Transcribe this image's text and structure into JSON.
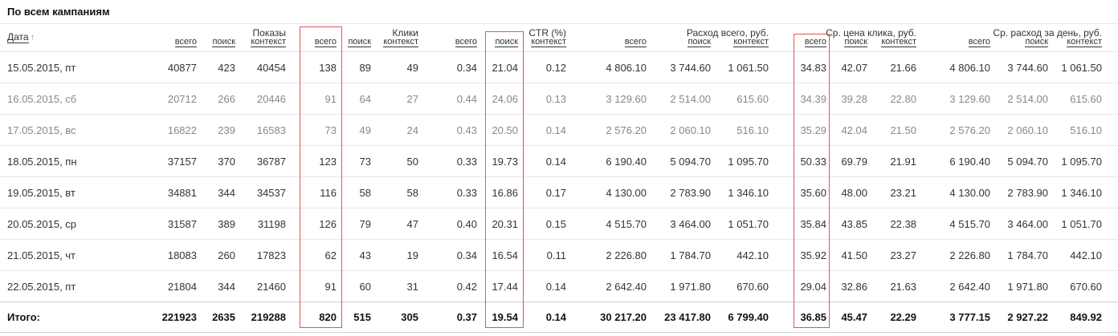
{
  "title": "По всем кампаниям",
  "headers": {
    "date": "Дата",
    "date_sort_icon": "arrow-up-icon",
    "vsego": "всего",
    "poisk": "поиск",
    "kontekst": "контекст",
    "groups": {
      "pokazy": "Показы",
      "kliki": "Клики",
      "ctr": "CTR (%)",
      "rashod": "Расход всего, руб.",
      "cena": "Ср. цена клика, руб.",
      "rashod_den": "Ср. расход за день, руб."
    }
  },
  "rows": [
    {
      "date": "15.05.2015, пт",
      "show_total": "40877",
      "show_search": "423",
      "show_context": "40454",
      "clicks_total": "138",
      "clicks_search": "89",
      "clicks_context": "49",
      "ctr_total": "0.34",
      "ctr_search": "21.04",
      "ctr_context": "0.12",
      "spend_total": "4 806.10",
      "spend_search": "3 744.60",
      "spend_context": "1 061.50",
      "cpc_total": "34.83",
      "cpc_search": "42.07",
      "cpc_context": "21.66",
      "day_total": "4 806.10",
      "day_search": "3 744.60",
      "day_context": "1 061.50"
    },
    {
      "date": "16.05.2015, сб",
      "show_total": "20712",
      "show_search": "266",
      "show_context": "20446",
      "clicks_total": "91",
      "clicks_search": "64",
      "clicks_context": "27",
      "ctr_total": "0.44",
      "ctr_search": "24.06",
      "ctr_context": "0.13",
      "spend_total": "3 129.60",
      "spend_search": "2 514.00",
      "spend_context": "615.60",
      "cpc_total": "34.39",
      "cpc_search": "39.28",
      "cpc_context": "22.80",
      "day_total": "3 129.60",
      "day_search": "2 514.00",
      "day_context": "615.60"
    },
    {
      "date": "17.05.2015, вс",
      "show_total": "16822",
      "show_search": "239",
      "show_context": "16583",
      "clicks_total": "73",
      "clicks_search": "49",
      "clicks_context": "24",
      "ctr_total": "0.43",
      "ctr_search": "20.50",
      "ctr_context": "0.14",
      "spend_total": "2 576.20",
      "spend_search": "2 060.10",
      "spend_context": "516.10",
      "cpc_total": "35.29",
      "cpc_search": "42.04",
      "cpc_context": "21.50",
      "day_total": "2 576.20",
      "day_search": "2 060.10",
      "day_context": "516.10"
    },
    {
      "date": "18.05.2015, пн",
      "show_total": "37157",
      "show_search": "370",
      "show_context": "36787",
      "clicks_total": "123",
      "clicks_search": "73",
      "clicks_context": "50",
      "ctr_total": "0.33",
      "ctr_search": "19.73",
      "ctr_context": "0.14",
      "spend_total": "6 190.40",
      "spend_search": "5 094.70",
      "spend_context": "1 095.70",
      "cpc_total": "50.33",
      "cpc_search": "69.79",
      "cpc_context": "21.91",
      "day_total": "6 190.40",
      "day_search": "5 094.70",
      "day_context": "1 095.70"
    },
    {
      "date": "19.05.2015, вт",
      "show_total": "34881",
      "show_search": "344",
      "show_context": "34537",
      "clicks_total": "116",
      "clicks_search": "58",
      "clicks_context": "58",
      "ctr_total": "0.33",
      "ctr_search": "16.86",
      "ctr_context": "0.17",
      "spend_total": "4 130.00",
      "spend_search": "2 783.90",
      "spend_context": "1 346.10",
      "cpc_total": "35.60",
      "cpc_search": "48.00",
      "cpc_context": "23.21",
      "day_total": "4 130.00",
      "day_search": "2 783.90",
      "day_context": "1 346.10"
    },
    {
      "date": "20.05.2015, ср",
      "show_total": "31587",
      "show_search": "389",
      "show_context": "31198",
      "clicks_total": "126",
      "clicks_search": "79",
      "clicks_context": "47",
      "ctr_total": "0.40",
      "ctr_search": "20.31",
      "ctr_context": "0.15",
      "spend_total": "4 515.70",
      "spend_search": "3 464.00",
      "spend_context": "1 051.70",
      "cpc_total": "35.84",
      "cpc_search": "43.85",
      "cpc_context": "22.38",
      "day_total": "4 515.70",
      "day_search": "3 464.00",
      "day_context": "1 051.70"
    },
    {
      "date": "21.05.2015, чт",
      "show_total": "18083",
      "show_search": "260",
      "show_context": "17823",
      "clicks_total": "62",
      "clicks_search": "43",
      "clicks_context": "19",
      "ctr_total": "0.34",
      "ctr_search": "16.54",
      "ctr_context": "0.11",
      "spend_total": "2 226.80",
      "spend_search": "1 784.70",
      "spend_context": "442.10",
      "cpc_total": "35.92",
      "cpc_search": "41.50",
      "cpc_context": "23.27",
      "day_total": "2 226.80",
      "day_search": "1 784.70",
      "day_context": "442.10"
    },
    {
      "date": "22.05.2015, пт",
      "show_total": "21804",
      "show_search": "344",
      "show_context": "21460",
      "clicks_total": "91",
      "clicks_search": "60",
      "clicks_context": "31",
      "ctr_total": "0.42",
      "ctr_search": "17.44",
      "ctr_context": "0.14",
      "spend_total": "2 642.40",
      "spend_search": "1 971.80",
      "spend_context": "670.60",
      "cpc_total": "29.04",
      "cpc_search": "32.86",
      "cpc_context": "21.63",
      "day_total": "2 642.40",
      "day_search": "1 971.80",
      "day_context": "670.60"
    }
  ],
  "totals": {
    "date": "Итого:",
    "show_total": "221923",
    "show_search": "2635",
    "show_context": "219288",
    "clicks_total": "820",
    "clicks_search": "515",
    "clicks_context": "305",
    "ctr_total": "0.37",
    "ctr_search": "19.54",
    "ctr_context": "0.14",
    "spend_total": "30 217.20",
    "spend_search": "23 417.80",
    "spend_context": "6 799.40",
    "cpc_total": "36.85",
    "cpc_search": "45.47",
    "cpc_context": "22.29",
    "day_total": "3 777.15",
    "day_search": "2 927.22",
    "day_context": "849.92"
  },
  "highlight_color": "#e0565b"
}
